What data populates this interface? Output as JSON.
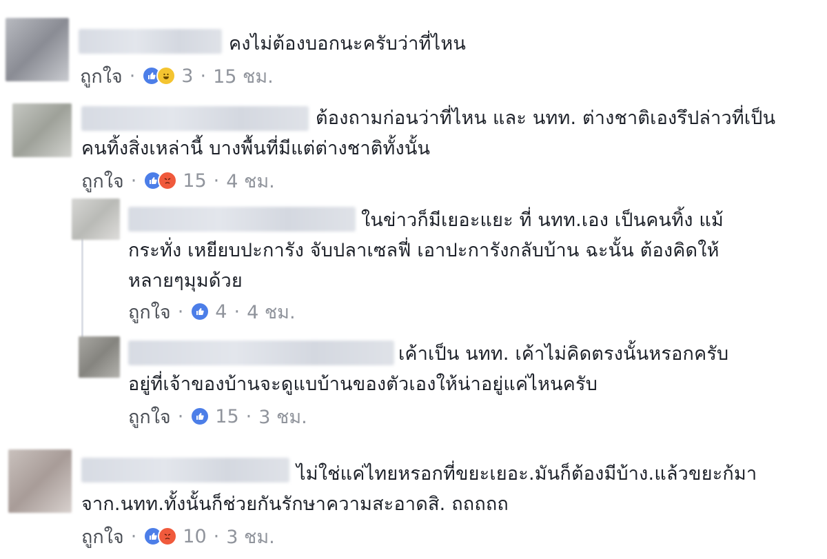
{
  "like_label": "ถูกใจ",
  "separator": "·",
  "comments": [
    {
      "text": "คงไม่ต้องบอกนะครับว่าที่ไหน",
      "reactions": [
        "like-icon",
        "haha-icon"
      ],
      "count": "3",
      "time": "15 ชม."
    },
    {
      "text": "ต้องถามก่อนว่าที่ไหน และ นทท. ต่างชาติเองรึปล่าวที่เป็นคนทิ้งสิ่งเหล่านี้ บางพื้นที่มีแต่ต่างชาติทั้งนั้น",
      "reactions": [
        "like-icon",
        "angry-icon"
      ],
      "count": "15",
      "time": "4 ชม."
    },
    {
      "text": "ในข่าวก็มีเยอะแยะ ที่ นทท.เอง เป็นคนทิ้ง แม้กระทั่ง เหยียบปะการัง จับปลาเซลฟี่ เอาปะการังกลับบ้าน ฉะนั้น ต้องคิดให้หลายๆมุมด้วย",
      "reactions": [
        "like-icon"
      ],
      "count": "4",
      "time": "4 ชม."
    },
    {
      "text": "เค้าเป็น นทท. เค้าไม่คิดตรงนั้นหรอกครับ อยู่ที่เจ้าของบ้านจะดูแบบ้านของตัวเองให้น่าอยู่แค่ไหนครับ",
      "reactions": [
        "like-icon"
      ],
      "count": "15",
      "time": "3 ชม."
    },
    {
      "text": "ไม่ใช่แค่ไทยหรอกที่ขยะเยอะ.มันก็ต้องมีบ้าง.แล้วขยะก้มาจาก.นทท.ทั้งนั้นก็ช่วยกันรักษาความสะอาดสิ. ถถถถถ",
      "reactions": [
        "like-icon",
        "angry-icon"
      ],
      "count": "10",
      "time": "3 ชม."
    }
  ],
  "colors": {
    "link_gray": "#90949c",
    "text": "#1d2129",
    "like_blue": "#4c7ee8",
    "angry_orange": "#f05a3c",
    "haha_yellow": "#f4c430"
  }
}
